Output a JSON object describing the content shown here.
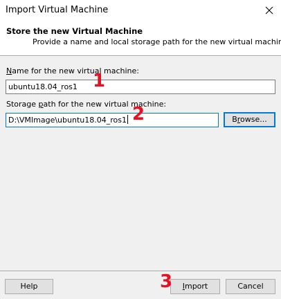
{
  "window": {
    "title": "Import Virtual Machine"
  },
  "header": {
    "title": "Store the new Virtual Machine",
    "subtitle": "Provide a name and local storage path for the new virtual machine."
  },
  "form": {
    "name_label_pre": "",
    "name_label_mnemonic": "N",
    "name_label_post": "ame for the new virtual machine:",
    "name_value": "ubuntu18.04_ros1",
    "path_label_pre": "Storage ",
    "path_label_mnemonic": "p",
    "path_label_post": "ath for the new virtual machine:",
    "path_value": "D:\\VMImage\\ubuntu18.04_ros1",
    "browse_pre": "B",
    "browse_mnemonic": "r",
    "browse_post": "owse..."
  },
  "buttons": {
    "help": "Help",
    "import_mnemonic": "I",
    "import_post": "mport",
    "cancel": "Cancel"
  },
  "annotations": {
    "step1": "1",
    "step2": "2",
    "step3": "3",
    "color": "#e81123"
  },
  "colors": {
    "focus_border": "#0078d7",
    "dialog_bg": "#f0f0f0",
    "header_bg": "#ffffff"
  },
  "icons": {
    "close": "close-icon"
  }
}
